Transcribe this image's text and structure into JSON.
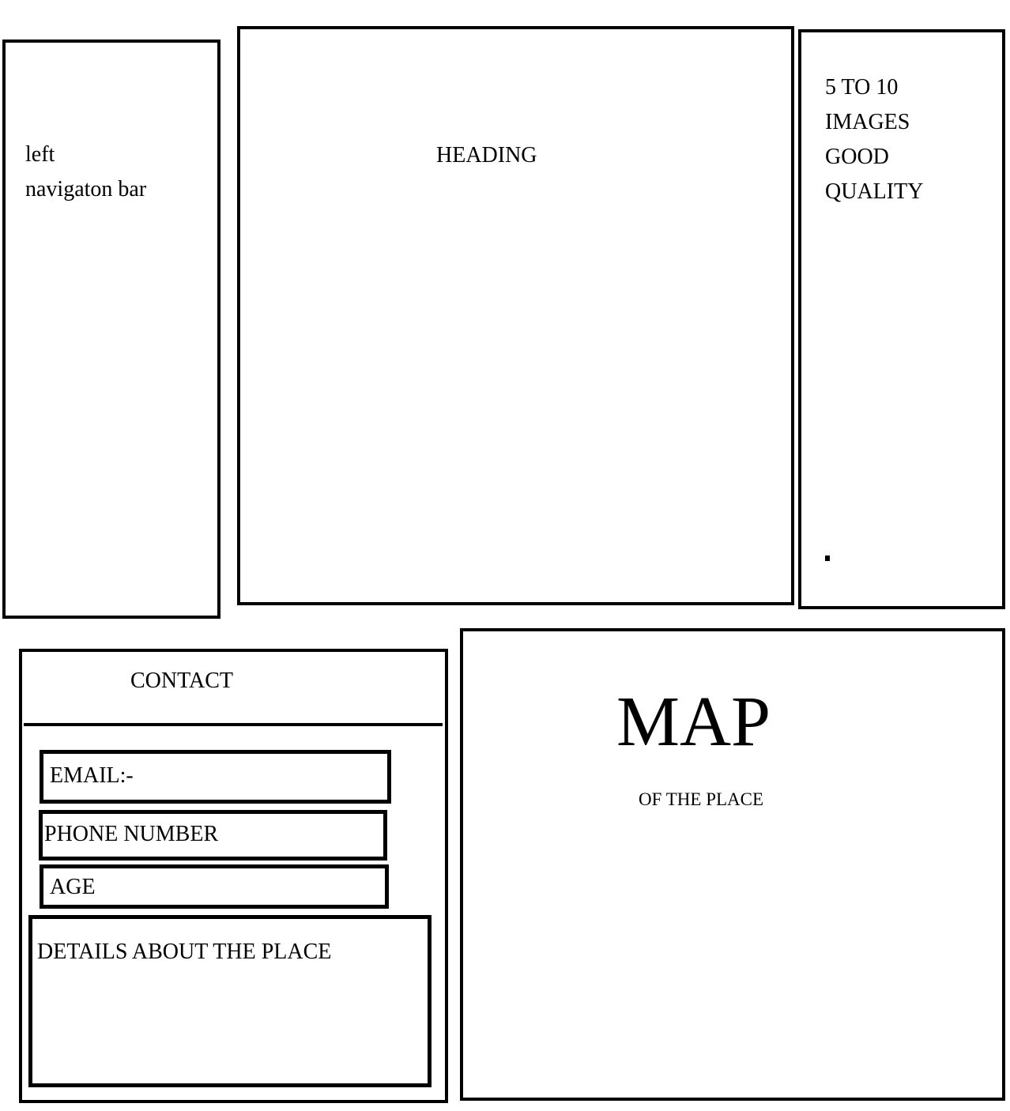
{
  "nav": {
    "lines": [
      "left",
      "navigaton bar"
    ]
  },
  "heading": {
    "label": "HEADING"
  },
  "images": {
    "lines": [
      "5 TO 10",
      "IMAGES",
      "GOOD",
      "QUALITY"
    ]
  },
  "contact": {
    "title": "CONTACT",
    "email_label": "EMAIL:-",
    "phone_label": "PHONE NUMBER",
    "age_label": "AGE",
    "details_label": "DETAILS ABOUT THE PLACE"
  },
  "map": {
    "title": "MAP",
    "subtitle": "OF THE PLACE"
  }
}
